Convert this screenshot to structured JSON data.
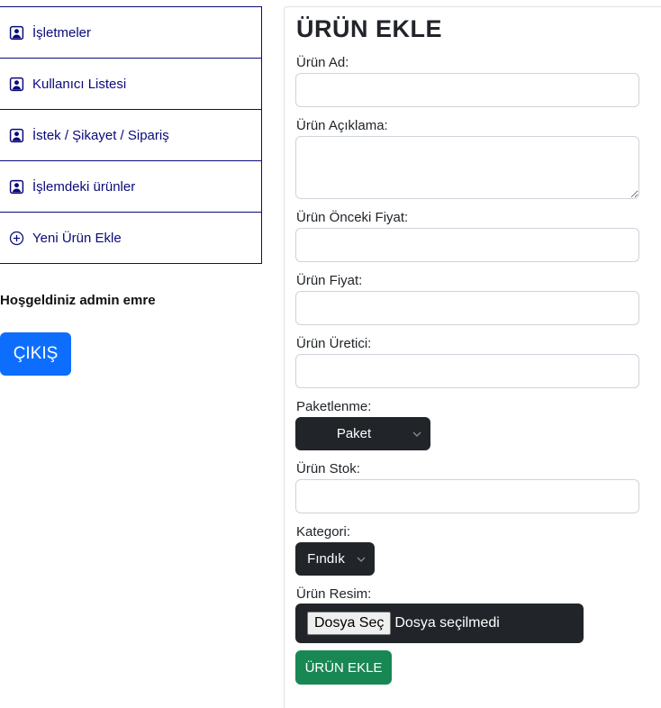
{
  "sidebar": {
    "items": [
      {
        "label": "İşletmeler",
        "icon": "person-badge-icon"
      },
      {
        "label": "Kullanıcı Listesi",
        "icon": "person-badge-icon"
      },
      {
        "label": "İstek / Şikayet / Sipariş",
        "icon": "person-badge-icon"
      },
      {
        "label": "İşlemdeki ürünler",
        "icon": "person-badge-icon"
      },
      {
        "label": "Yeni Ürün Ekle",
        "icon": "plus-circle-icon"
      }
    ],
    "welcome": "Hoşgeldiniz admin emre",
    "logout_label": "ÇIKIŞ"
  },
  "form": {
    "title": "ÜRÜN EKLE",
    "labels": {
      "name": "Ürün Ad:",
      "description": "Ürün Açıklama:",
      "previous_price": "Ürün Önceki Fiyat:",
      "price": "Ürün Fiyat:",
      "producer": "Ürün Üretici:",
      "packaging": "Paketlenme:",
      "stock": "Ürün Stok:",
      "category": "Kategori:",
      "image": "Ürün Resim:"
    },
    "values": {
      "name": "",
      "description": "",
      "previous_price": "",
      "price": "",
      "producer": "",
      "stock": ""
    },
    "packaging_selected": "Paket",
    "category_selected": "Fındık",
    "file_button": "Dosya Seç",
    "file_status": "Dosya seçilmedi",
    "submit_label": "ÜRÜN EKLE"
  },
  "colors": {
    "sidebar_border": "#0a0a7a",
    "logout_bg": "#0d6efd",
    "submit_bg": "#198754",
    "dark_control_bg": "#212529"
  }
}
